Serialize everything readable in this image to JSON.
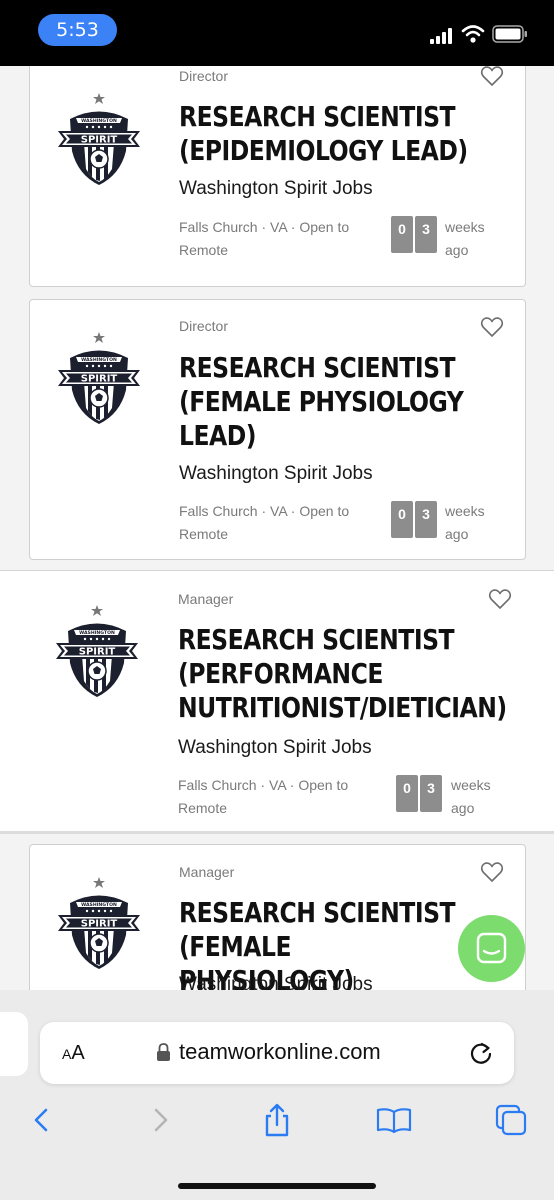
{
  "status_bar": {
    "time": "5:53"
  },
  "jobs": [
    {
      "category": "Director",
      "title": "RESEARCH SCIENTIST\n(EPIDEMIOLOGY LEAD)",
      "company": "Washington Spirit Jobs",
      "location": "Falls Church · VA · Open to Remote",
      "age_digits": [
        "0",
        "3"
      ],
      "age_unit": "weeks ago"
    },
    {
      "category": "Director",
      "title": "RESEARCH SCIENTIST\n(FEMALE PHYSIOLOGY\nLEAD)",
      "company": "Washington Spirit Jobs",
      "location": "Falls Church · VA · Open to Remote",
      "age_digits": [
        "0",
        "3"
      ],
      "age_unit": "weeks ago"
    },
    {
      "category": "Manager",
      "title": "RESEARCH SCIENTIST\n(PERFORMANCE\nNUTRITIONIST/DIETICIAN)",
      "company": "Washington Spirit Jobs",
      "location": "Falls Church · VA · Open to Remote",
      "age_digits": [
        "0",
        "3"
      ],
      "age_unit": "weeks ago"
    },
    {
      "category": "Manager",
      "title": "RESEARCH SCIENTIST\n(FEMALE PHYSIOLOGY)",
      "company": "Washington Spirit Jobs"
    }
  ],
  "logo": {
    "text_top": "WASHINGTON",
    "text_main": "SPIRIT"
  },
  "browser": {
    "aa_label_small": "A",
    "aa_label_large": "A",
    "url": "teamworkonline.com"
  },
  "icons": {
    "favorite": "heart-outline-icon",
    "chat": "chat-bubble-icon",
    "back": "chevron-left-icon",
    "forward": "chevron-right-icon",
    "share": "share-icon",
    "bookmarks": "book-icon",
    "tabs": "tabs-icon"
  },
  "colors": {
    "accent_blue": "#3b82f6",
    "chat_green": "#7ddc6e",
    "digit_gray": "#8d8d8d",
    "logo_navy": "#1c1f2e"
  }
}
